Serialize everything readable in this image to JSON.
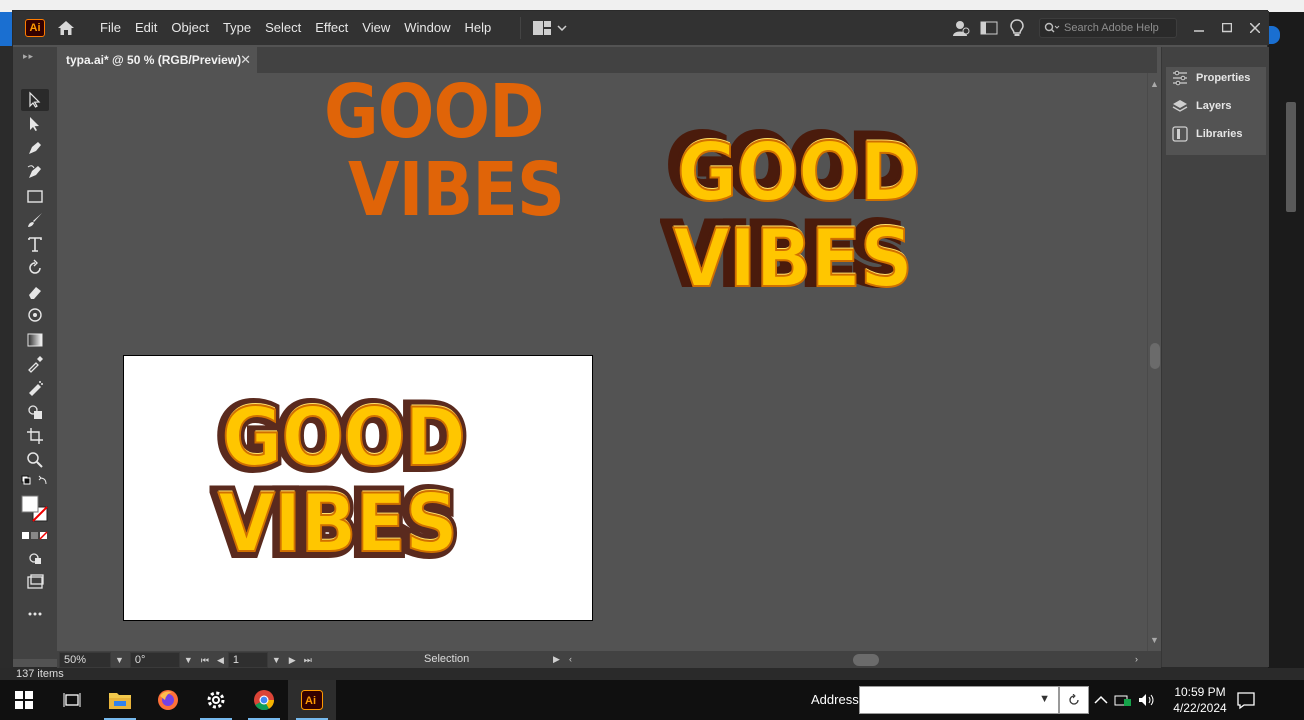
{
  "app": {
    "name": "Adobe Illustrator",
    "logo_text": "Ai"
  },
  "menu": {
    "items": [
      "File",
      "Edit",
      "Object",
      "Type",
      "Select",
      "Effect",
      "View",
      "Window",
      "Help"
    ]
  },
  "search": {
    "placeholder": "Search Adobe Help"
  },
  "document": {
    "tab_title": "typa.ai* @ 50 % (RGB/Preview)"
  },
  "artwork": {
    "line1": "GOOD",
    "line2": "VIBES"
  },
  "status": {
    "zoom": "50%",
    "rotation": "0°",
    "artboard": "1",
    "tool_label": "Selection"
  },
  "panels": {
    "items": [
      "Properties",
      "Layers",
      "Libraries"
    ]
  },
  "behind_window": {
    "status_text": "137 items"
  },
  "taskbar": {
    "address_label": "Address",
    "time": "10:59 PM",
    "date": "4/22/2024"
  },
  "colors": {
    "accent_orange": "#e06408",
    "yellow_fill": "#ffc600",
    "shadow_brown": "#4a1b0c"
  }
}
